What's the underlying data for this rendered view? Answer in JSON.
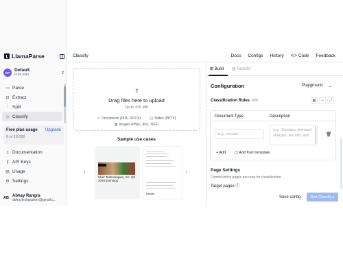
{
  "app": {
    "name": "LlamaParse"
  },
  "workspace": {
    "name": "Default",
    "plan": "Free plan",
    "initials": "DP"
  },
  "sidebar": {
    "items": [
      {
        "label": "Parse",
        "icon": "document-icon"
      },
      {
        "label": "Extract",
        "icon": "extract-icon"
      },
      {
        "label": "Split",
        "icon": "split-icon"
      },
      {
        "label": "Classify",
        "icon": "tag-icon",
        "active": true
      }
    ],
    "usage": {
      "title": "Free plan usage",
      "upgrade_label": "Upgrade",
      "count": "0 of 10,000"
    },
    "secondary": [
      {
        "label": "Documentation",
        "icon": "book-icon"
      },
      {
        "label": "API Keys",
        "icon": "key-icon"
      },
      {
        "label": "Usage",
        "icon": "usage-icon"
      },
      {
        "label": "Settings",
        "icon": "gear-icon"
      }
    ],
    "user": {
      "initials": "AB",
      "name": "Abhay Rangra",
      "email": "abhaytechpuskey@gmail.c..."
    }
  },
  "header": {
    "title": "Classify",
    "nav": [
      "Docs",
      "Configs",
      "History",
      "</> Code",
      "Feedback"
    ]
  },
  "upload": {
    "title": "Drag files here to upload",
    "subtitle": "Up to 315 MB",
    "formats": [
      "Documents (PDF, DOCX)",
      "Slides (PPTX)",
      "Images (PNG, JPG, TIFF)"
    ]
  },
  "samples": {
    "title": "Sample use cases",
    "card1_text": "Uber Technologies, Inc. Q1 2025 Earnings",
    "card2_footer": "Deloitte"
  },
  "panel": {
    "tabs": [
      "Build",
      "Results"
    ],
    "configuration_title": "Configuration",
    "preset": "Playground",
    "rules_label": "Classification Rules",
    "rules_count": "1/20",
    "col_document_type": "Document Type",
    "col_description": "Description",
    "doc_type_placeholder": "e.g., invoice",
    "description_placeholder": "e.g., Contains itemized charges, tax info, and",
    "add_label": "+  Add",
    "add_template_label": "Add from template",
    "page_settings_title": "Page Settings",
    "page_settings_sub": "Control which pages are read for classification.",
    "target_pages_label": "Target pages",
    "save_label": "Save config",
    "run_label": "Run Classify"
  },
  "colors": {
    "accent": "#2563eb",
    "run_button": "#9db8f5",
    "workspace_avatar": "#6d5ae6"
  }
}
